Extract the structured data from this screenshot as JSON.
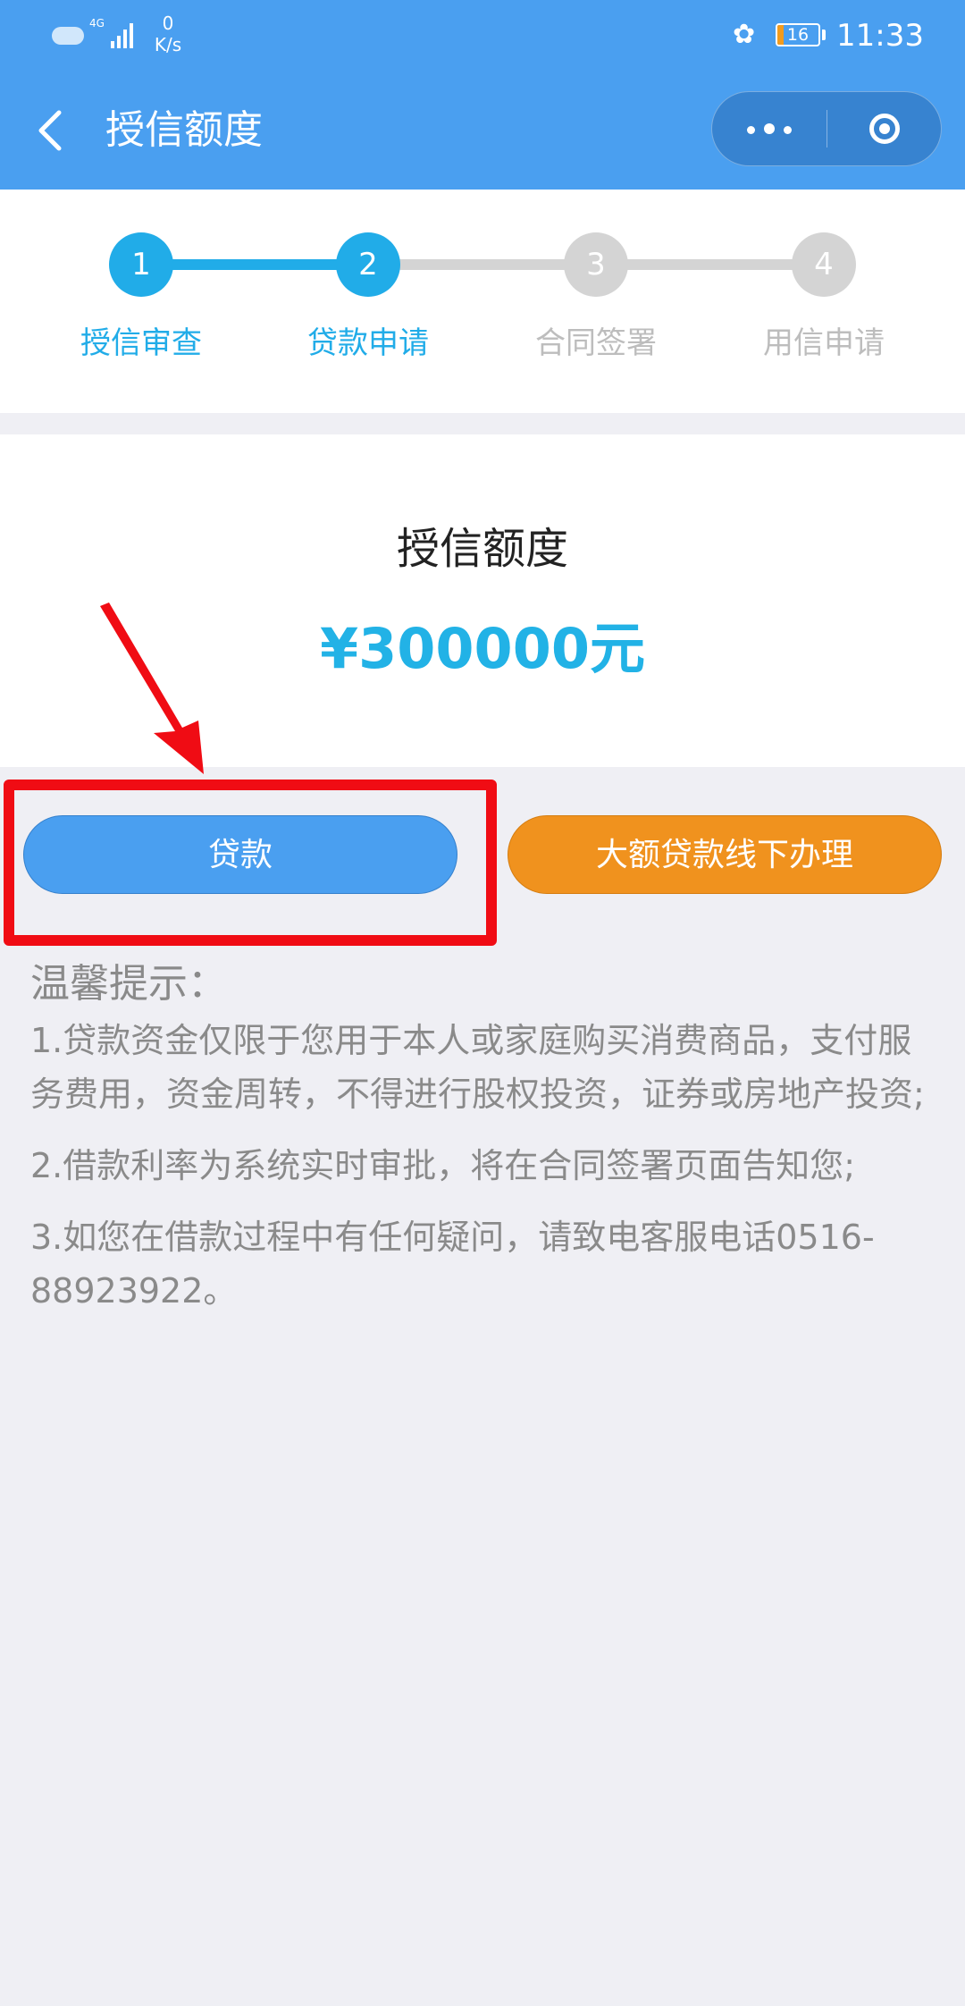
{
  "status_bar": {
    "network": "4G",
    "speed_value": "0",
    "speed_unit": "K/s",
    "battery": "16",
    "battery_level": 0.16,
    "time": "11:33"
  },
  "nav": {
    "title": "授信额度",
    "back_icon": "chevron-left-icon",
    "more_icon": "more-dots-icon",
    "close_icon": "target-circle-icon"
  },
  "steps": [
    {
      "number": "1",
      "label": "授信审查",
      "state": "done"
    },
    {
      "number": "2",
      "label": "贷款申请",
      "state": "done"
    },
    {
      "number": "3",
      "label": "合同签署",
      "state": "todo"
    },
    {
      "number": "4",
      "label": "用信申请",
      "state": "todo"
    }
  ],
  "credit": {
    "title": "授信额度",
    "amount": "¥300000元"
  },
  "buttons": {
    "loan": "贷款",
    "offline": "大额贷款线下办理"
  },
  "tips": {
    "title": "温馨提示：",
    "items": [
      "1.贷款资金仅限于您用于本人或家庭购买消费商品，支付服务费用，资金周转，不得进行股权投资，证券或房地产投资;",
      "2.借款利率为系统实时审批，将在合同签署页面告知您;",
      "3.如您在借款过程中有任何疑问，请致电客服电话0516-88923922。"
    ]
  },
  "colors": {
    "header": "#4a9ff0",
    "step_active": "#21ace8",
    "step_inactive": "#d4d4d4",
    "amount": "#22b2e6",
    "offline_button": "#f0921e",
    "highlight": "#f00c14",
    "page_bg": "#efeff4"
  }
}
